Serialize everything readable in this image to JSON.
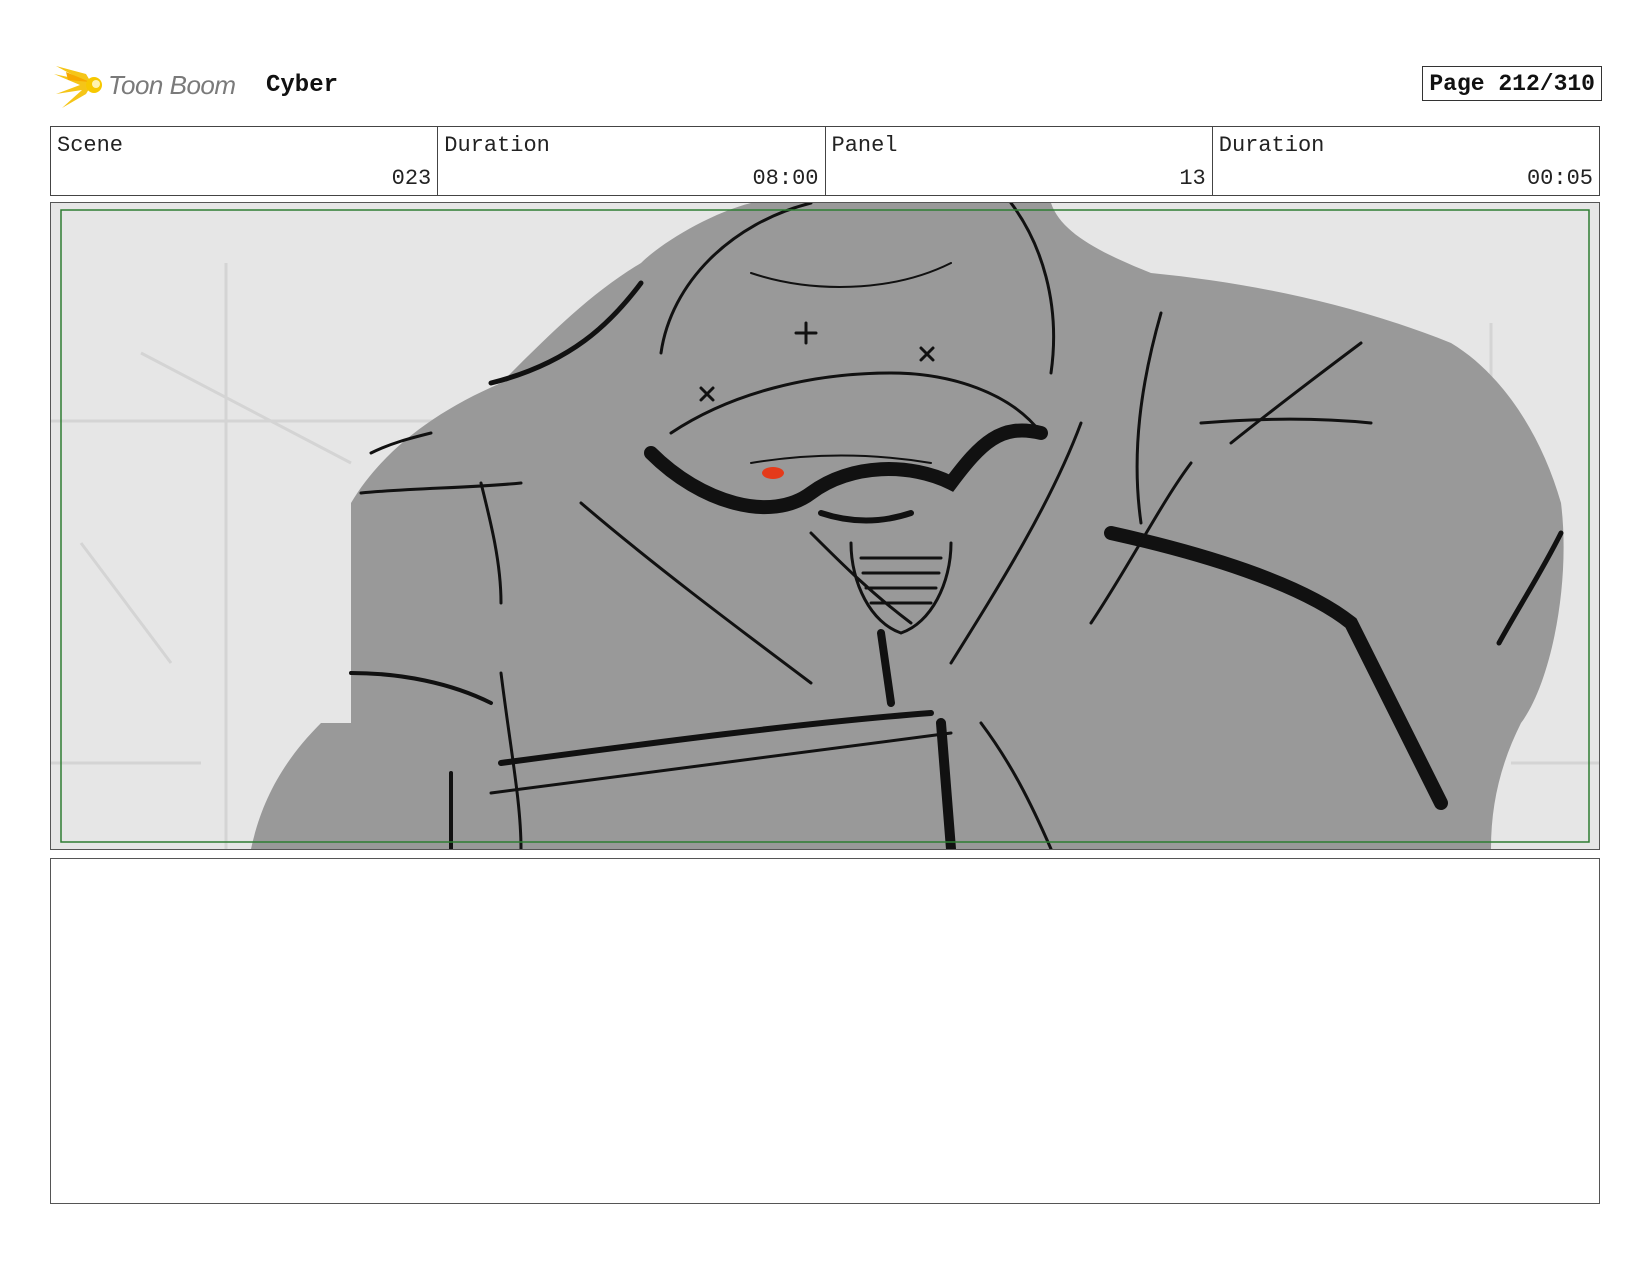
{
  "header": {
    "logo_icon": "toon-boom-starburst-icon",
    "brand": "Toon Boom",
    "project": "Cyber",
    "page_label": "Page 212/310"
  },
  "info": {
    "scene_label": "Scene",
    "scene_value": "023",
    "scene_duration_label": "Duration",
    "scene_duration_value": "08:00",
    "panel_label": "Panel",
    "panel_value": "13",
    "panel_duration_label": "Duration",
    "panel_duration_value": "00:05"
  },
  "panel": {
    "safe_area_color": "#2e7d32",
    "eye_color": "#e53a1a"
  },
  "notes": {
    "text": ""
  }
}
